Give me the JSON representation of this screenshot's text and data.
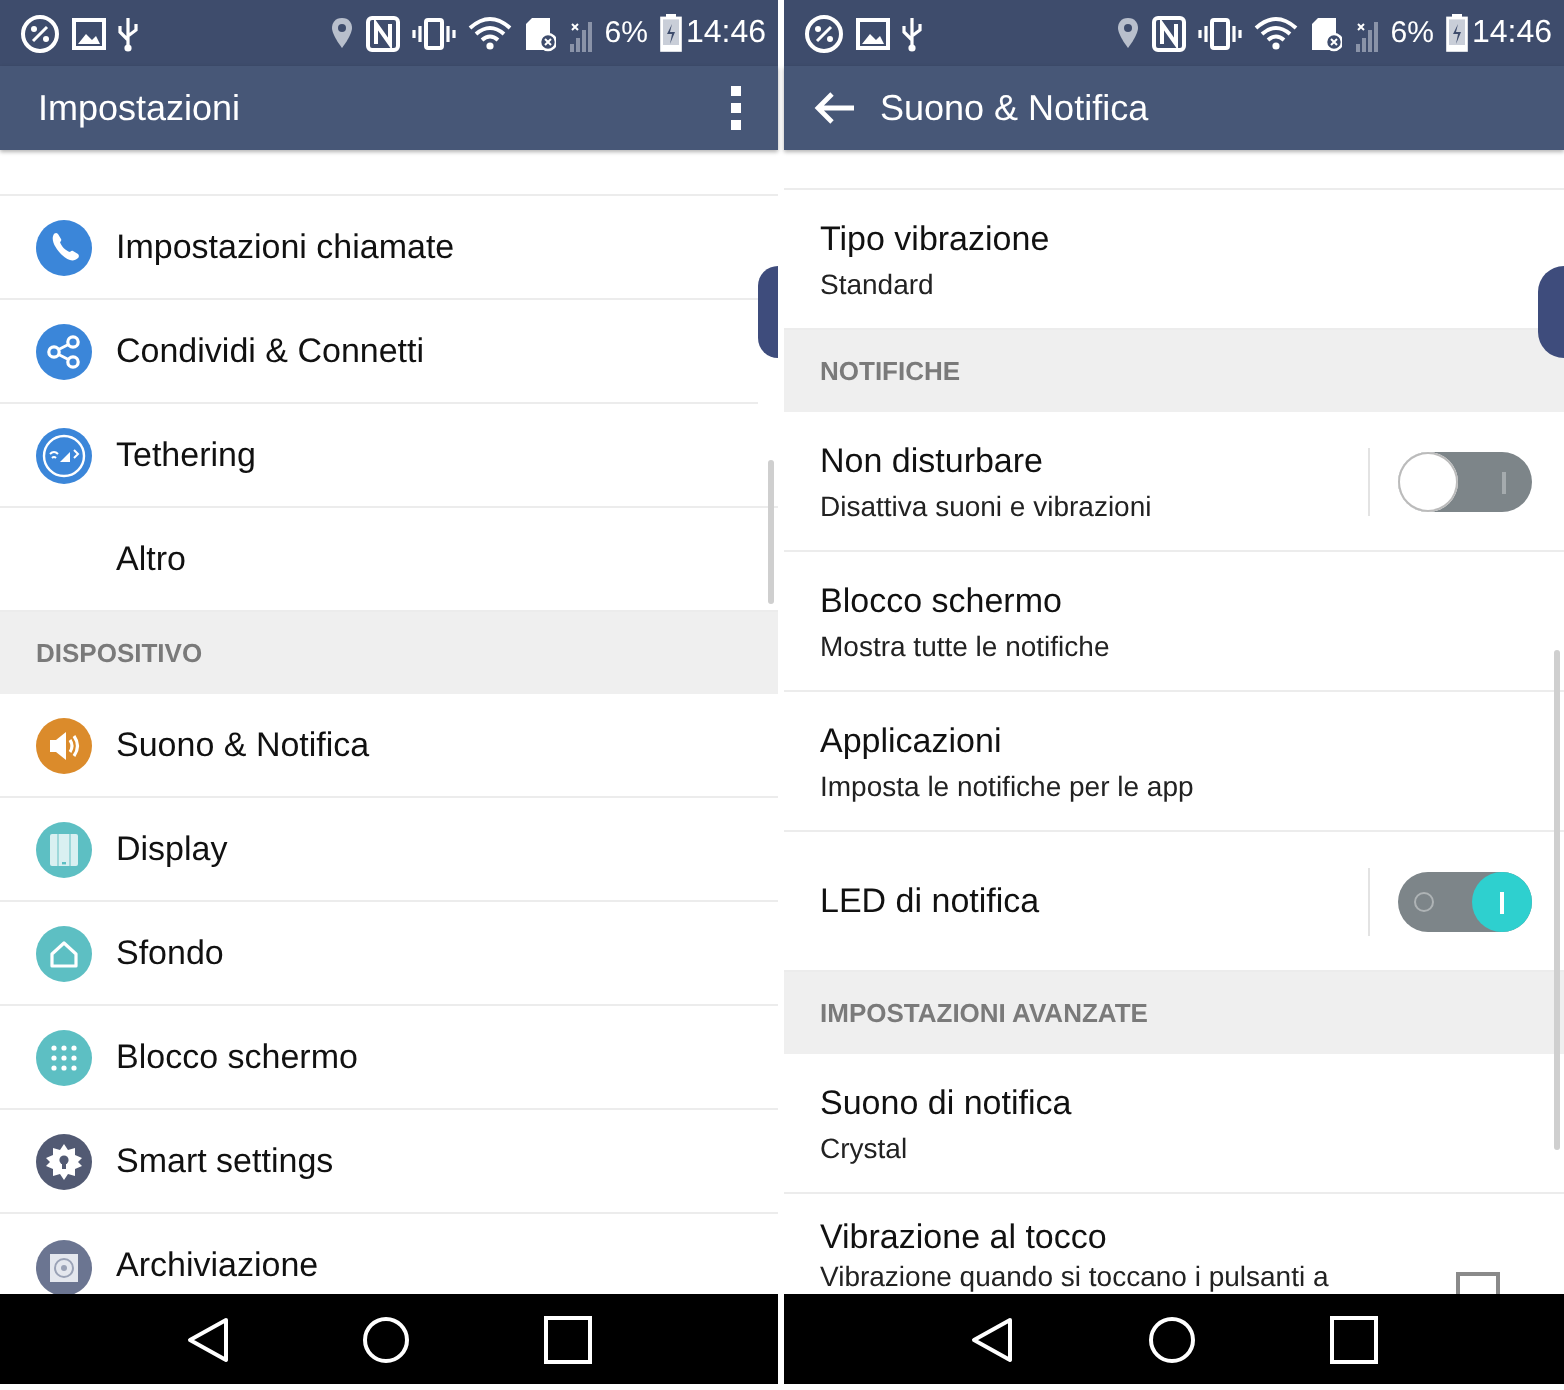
{
  "screens": [
    {
      "status_bar": {
        "battery": "6%",
        "time": "14:46"
      },
      "app_bar": {
        "kind": "menu",
        "title": "Impostazioni"
      },
      "items": [
        {
          "kind": "row",
          "title": "Impostazioni chiamate"
        },
        {
          "kind": "row",
          "title": "Condividi & Connetti"
        },
        {
          "kind": "row",
          "title": "Tethering"
        },
        {
          "kind": "row",
          "title": "Altro"
        },
        {
          "kind": "header",
          "title": "DISPOSITIVO"
        },
        {
          "kind": "row",
          "title": "Suono & Notifica"
        },
        {
          "kind": "row",
          "title": "Display"
        },
        {
          "kind": "row",
          "title": "Sfondo"
        },
        {
          "kind": "row",
          "title": "Blocco schermo"
        },
        {
          "kind": "row",
          "title": "Smart settings"
        },
        {
          "kind": "row",
          "title": "Archiviazione"
        }
      ]
    },
    {
      "status_bar": {
        "battery": "6%",
        "time": "14:46"
      },
      "app_bar": {
        "kind": "back",
        "title": "Suono & Notifica"
      },
      "items": [
        {
          "kind": "row",
          "title": "Tipo vibrazione",
          "subtitle": "Standard"
        },
        {
          "kind": "header",
          "title": "NOTIFICHE"
        },
        {
          "kind": "switch",
          "title": "Non disturbare",
          "subtitle": "Disattiva suoni e vibrazioni",
          "on": false
        },
        {
          "kind": "row",
          "title": "Blocco schermo",
          "subtitle": "Mostra tutte le notifiche"
        },
        {
          "kind": "row",
          "title": "Applicazioni",
          "subtitle": "Imposta le notifiche per le app"
        },
        {
          "kind": "switch",
          "title": "LED di notifica",
          "on": true
        },
        {
          "kind": "header",
          "title": "IMPOSTAZIONI AVANZATE"
        },
        {
          "kind": "row",
          "title": "Suono di notifica",
          "subtitle": "Crystal"
        },
        {
          "kind": "checkbox",
          "title": "Vibrazione al tocco",
          "subtitle": "Vibrazione quando si toccano i pulsanti a",
          "checked": false
        }
      ]
    }
  ]
}
